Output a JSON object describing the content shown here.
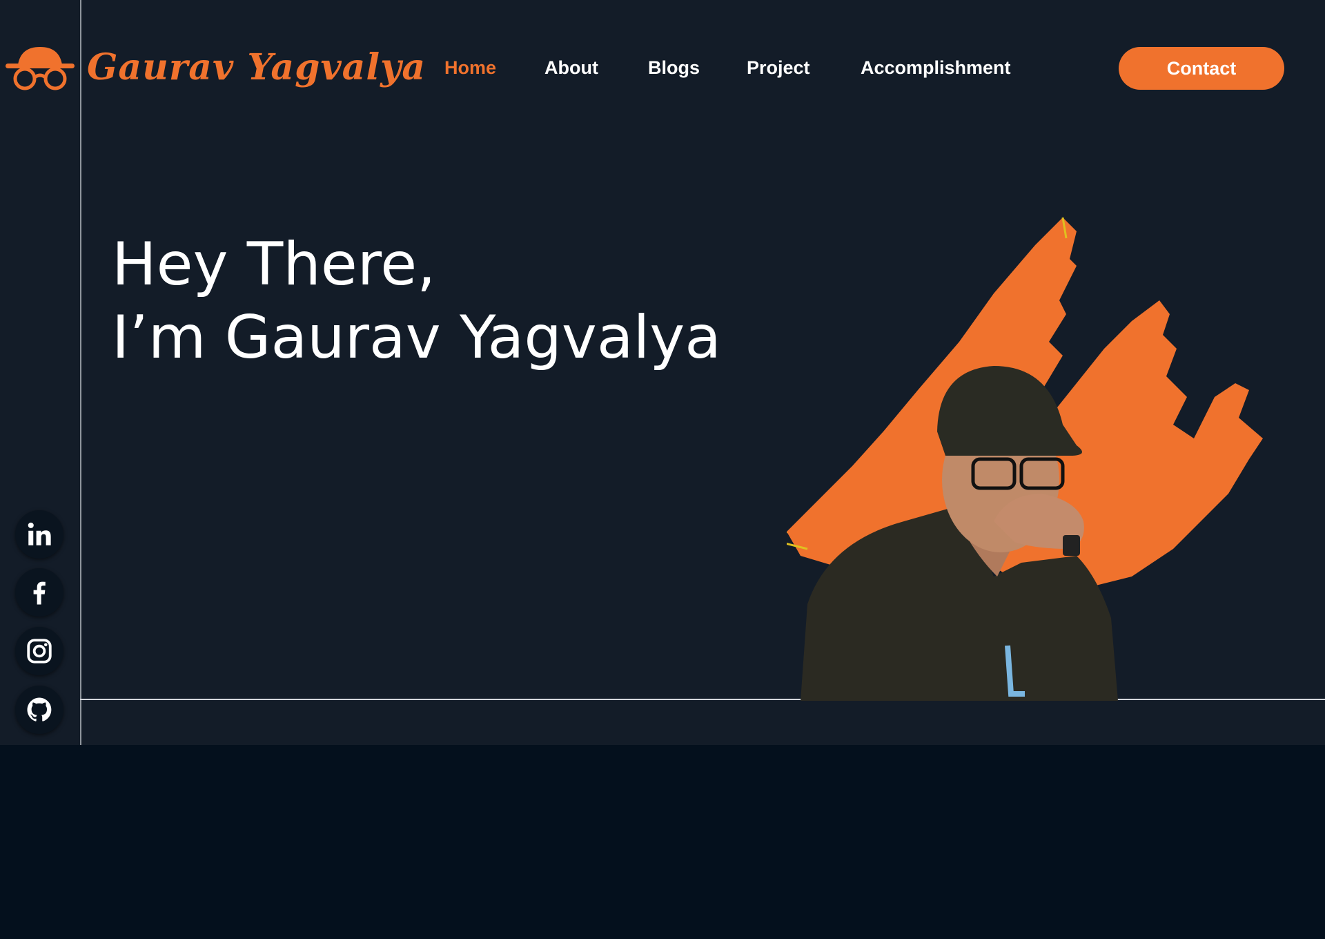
{
  "brand": {
    "name": "Gaurav Yagvalya",
    "logo_icon": "hat-glasses-icon",
    "accent_color": "#f0722d"
  },
  "nav": {
    "items": [
      {
        "label": "Home",
        "active": true
      },
      {
        "label": "About",
        "active": false
      },
      {
        "label": "Blogs",
        "active": false
      },
      {
        "label": "Project",
        "active": false
      },
      {
        "label": "Accomplishment",
        "active": false
      }
    ],
    "contact_label": "Contact"
  },
  "hero": {
    "line1": "Hey There,",
    "line2": "I’m Gaurav Yagvalya"
  },
  "social": [
    {
      "name": "linkedin-icon"
    },
    {
      "name": "facebook-icon"
    },
    {
      "name": "instagram-icon"
    },
    {
      "name": "github-icon"
    }
  ],
  "colors": {
    "background": "#131c28",
    "footer": "#04101d",
    "text": "#ffffff"
  }
}
